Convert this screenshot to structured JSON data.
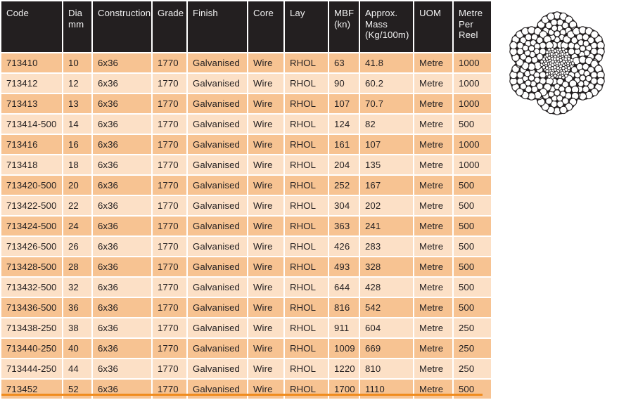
{
  "table": {
    "name": "wire-rope-specification-table",
    "columns": [
      {
        "key": "code",
        "lines": [
          "Code"
        ]
      },
      {
        "key": "dia",
        "lines": [
          "Dia",
          "mm"
        ]
      },
      {
        "key": "con",
        "lines": [
          "Construction"
        ]
      },
      {
        "key": "grade",
        "lines": [
          "Grade"
        ]
      },
      {
        "key": "fin",
        "lines": [
          "Finish"
        ]
      },
      {
        "key": "core",
        "lines": [
          "Core"
        ]
      },
      {
        "key": "lay",
        "lines": [
          "Lay"
        ]
      },
      {
        "key": "mbf",
        "lines": [
          "MBF",
          "(kn)"
        ]
      },
      {
        "key": "mass",
        "lines": [
          "Approx.",
          "Mass",
          "(Kg/100m)"
        ]
      },
      {
        "key": "uom",
        "lines": [
          "UOM"
        ]
      },
      {
        "key": "reel",
        "lines": [
          "Metre",
          "Per",
          "Reel"
        ]
      }
    ],
    "rows": [
      [
        "713410",
        "10",
        "6x36",
        "1770",
        "Galvanised",
        "Wire",
        "RHOL",
        "63",
        "41.8",
        "Metre",
        "1000"
      ],
      [
        "713412",
        "12",
        "6x36",
        "1770",
        "Galvanised",
        "Wire",
        "RHOL",
        "90",
        "60.2",
        "Metre",
        "1000"
      ],
      [
        "713413",
        "13",
        "6x36",
        "1770",
        "Galvanised",
        "Wire",
        "RHOL",
        "107",
        "70.7",
        "Metre",
        "1000"
      ],
      [
        "713414-500",
        "14",
        "6x36",
        "1770",
        "Galvanised",
        "Wire",
        "RHOL",
        "124",
        "82",
        "Metre",
        "500"
      ],
      [
        "713416",
        "16",
        "6x36",
        "1770",
        "Galvanised",
        "Wire",
        "RHOL",
        "161",
        "107",
        "Metre",
        "1000"
      ],
      [
        "713418",
        "18",
        "6x36",
        "1770",
        "Galvanised",
        "Wire",
        "RHOL",
        "204",
        "135",
        "Metre",
        "1000"
      ],
      [
        "713420-500",
        "20",
        "6x36",
        "1770",
        "Galvanised",
        "Wire",
        "RHOL",
        "252",
        "167",
        "Metre",
        "500"
      ],
      [
        "713422-500",
        "22",
        "6x36",
        "1770",
        "Galvanised",
        "Wire",
        "RHOL",
        "304",
        "202",
        "Metre",
        "500"
      ],
      [
        "713424-500",
        "24",
        "6x36",
        "1770",
        "Galvanised",
        "Wire",
        "RHOL",
        "363",
        "241",
        "Metre",
        "500"
      ],
      [
        "713426-500",
        "26",
        "6x36",
        "1770",
        "Galvanised",
        "Wire",
        "RHOL",
        "426",
        "283",
        "Metre",
        "500"
      ],
      [
        "713428-500",
        "28",
        "6x36",
        "1770",
        "Galvanised",
        "Wire",
        "RHOL",
        "493",
        "328",
        "Metre",
        "500"
      ],
      [
        "713432-500",
        "32",
        "6x36",
        "1770",
        "Galvanised",
        "Wire",
        "RHOL",
        "644",
        "428",
        "Metre",
        "500"
      ],
      [
        "713436-500",
        "36",
        "6x36",
        "1770",
        "Galvanised",
        "Wire",
        "RHOL",
        "816",
        "542",
        "Metre",
        "500"
      ],
      [
        "713438-250",
        "38",
        "6x36",
        "1770",
        "Galvanised",
        "Wire",
        "RHOL",
        "911",
        "604",
        "Metre",
        "250"
      ],
      [
        "713440-250",
        "40",
        "6x36",
        "1770",
        "Galvanised",
        "Wire",
        "RHOL",
        "1009",
        "669",
        "Metre",
        "250"
      ],
      [
        "713444-250",
        "44",
        "6x36",
        "1770",
        "Galvanised",
        "Wire",
        "RHOL",
        "1220",
        "810",
        "Metre",
        "250"
      ],
      [
        "713452",
        "52",
        "6x36",
        "1770",
        "Galvanised",
        "Wire",
        "RHOL",
        "1700",
        "1110",
        "Metre",
        "500"
      ]
    ]
  },
  "figure": {
    "name": "wire-rope-cross-section-diagram",
    "construction": "6x36",
    "core_type": "IWRC",
    "outer_strand_count": 6
  },
  "colors": {
    "header_bg": "#231f20",
    "header_text": "#f2f2f2",
    "row_odd_bg": "#f7c392",
    "row_even_bg": "#fce0c6",
    "body_text": "#231f20",
    "bottom_rule": "#f08c1e",
    "diagram_dark": "#231f20",
    "diagram_wire": "#ffffff",
    "page_bg": "#ffffff"
  }
}
